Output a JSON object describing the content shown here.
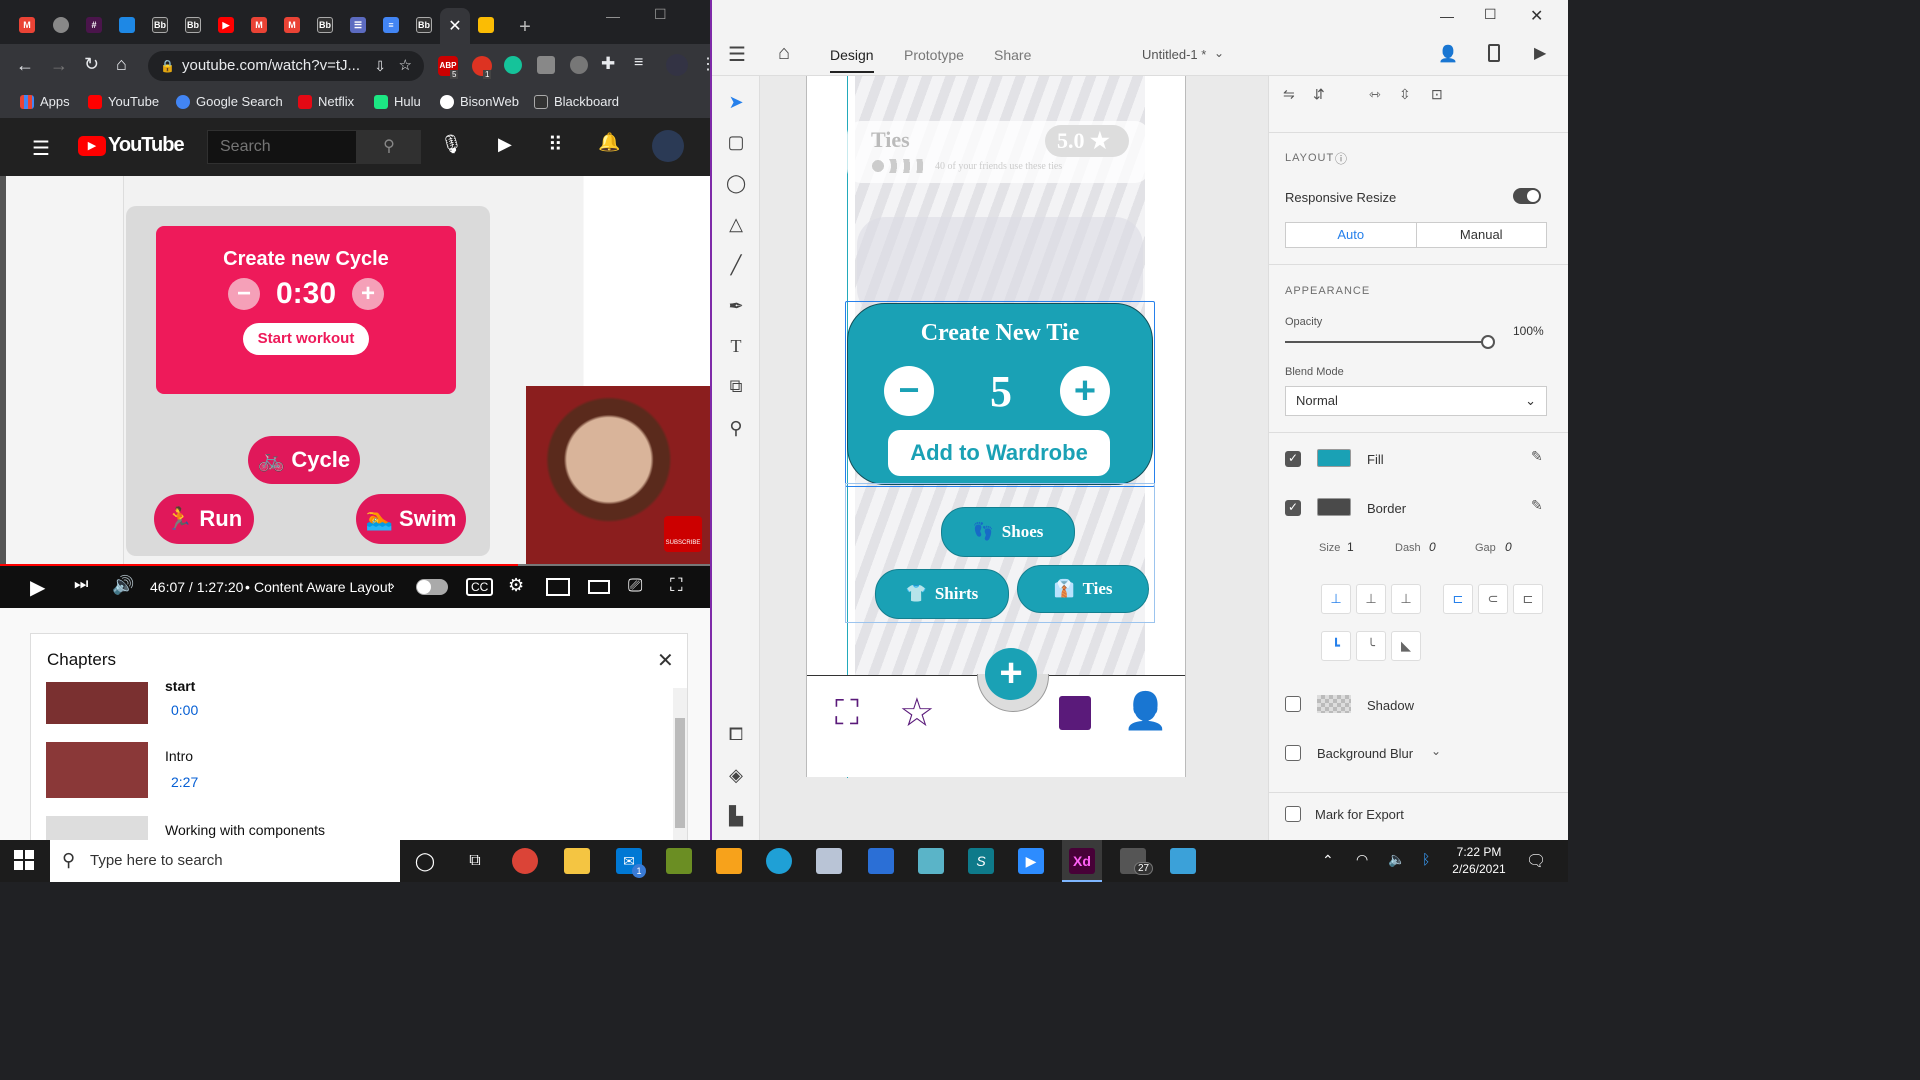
{
  "browser": {
    "url": "youtube.com/watch?v=tJ...",
    "tab_favicons": [
      "gmail",
      "chrome",
      "slack",
      "store",
      "bb",
      "bb",
      "youtube",
      "gmail",
      "gmail",
      "bb",
      "list",
      "docs",
      "bb",
      "close",
      "slides"
    ],
    "bookmarks": [
      "Apps",
      "YouTube",
      "Google Search",
      "Netflix",
      "Hulu",
      "BisonWeb",
      "Blackboard"
    ],
    "extension_badges": {
      "abp": "5",
      "ext2": "1"
    }
  },
  "youtube": {
    "logo": "YouTube",
    "search_placeholder": "Search",
    "video_inner": {
      "card_title": "Create new Cycle",
      "card_time": "0:30",
      "card_button": "Start workout",
      "chip_cycle": "Cycle",
      "chip_run": "Run",
      "chip_swim": "Swim",
      "subscribe": "SUBSCRIBE"
    },
    "time_display": "46:07 / 1:27:20",
    "chapter_current": "Content Aware Layout",
    "chapters_title": "Chapters",
    "chapters": [
      {
        "title": "start",
        "time": "0:00"
      },
      {
        "title": "Intro",
        "time": "2:27"
      },
      {
        "title": "Working with components",
        "time": ""
      }
    ]
  },
  "xd": {
    "tabs": [
      "Design",
      "Prototype",
      "Share"
    ],
    "active_tab": "Design",
    "doc_title": "Untitled-1 *",
    "artboard": {
      "top_card_title": "Ties",
      "top_card_rating": "5.0",
      "top_card_sub": "40 of your friends use these ties",
      "component_title": "Create New Tie",
      "component_count": "5",
      "component_button": "Add to Wardrobe",
      "btn_shoes": "Shoes",
      "btn_shirts": "Shirts",
      "btn_ties": "Ties"
    },
    "props": {
      "layout_label": "LAYOUT",
      "responsive_resize": "Responsive Resize",
      "seg_auto": "Auto",
      "seg_manual": "Manual",
      "appearance_label": "APPEARANCE",
      "opacity_label": "Opacity",
      "opacity_value": "100%",
      "blend_label": "Blend Mode",
      "blend_value": "Normal",
      "fill_label": "Fill",
      "fill_color": "#1aa1b5",
      "border_label": "Border",
      "border_color": "#4a4a4a",
      "size_label": "Size",
      "size_value": "1",
      "dash_label": "Dash",
      "dash_value": "0",
      "gap_label": "Gap",
      "gap_value": "0",
      "shadow_label": "Shadow",
      "blur_label": "Background Blur",
      "export_label": "Mark for Export"
    }
  },
  "taskbar": {
    "search_placeholder": "Type here to search",
    "time": "7:22 PM",
    "date": "2/26/2021",
    "mail_badge": "1",
    "chat_badge": "27"
  },
  "colors": {
    "xd_teal": "#1aa1b5",
    "yt_pink": "#ee1a5a",
    "purple_icons": "#5a1a7a",
    "xd_blue": "#2680eb"
  }
}
